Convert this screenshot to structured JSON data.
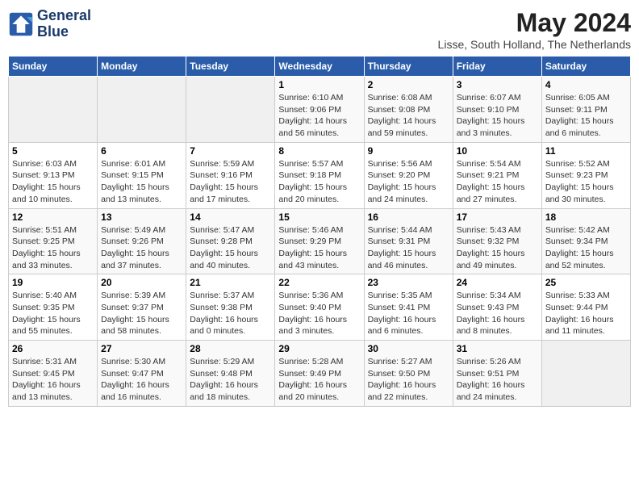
{
  "header": {
    "logo_line1": "General",
    "logo_line2": "Blue",
    "month": "May 2024",
    "location": "Lisse, South Holland, The Netherlands"
  },
  "days_of_week": [
    "Sunday",
    "Monday",
    "Tuesday",
    "Wednesday",
    "Thursday",
    "Friday",
    "Saturday"
  ],
  "weeks": [
    [
      {
        "day": "",
        "info": ""
      },
      {
        "day": "",
        "info": ""
      },
      {
        "day": "",
        "info": ""
      },
      {
        "day": "1",
        "info": "Sunrise: 6:10 AM\nSunset: 9:06 PM\nDaylight: 14 hours\nand 56 minutes."
      },
      {
        "day": "2",
        "info": "Sunrise: 6:08 AM\nSunset: 9:08 PM\nDaylight: 14 hours\nand 59 minutes."
      },
      {
        "day": "3",
        "info": "Sunrise: 6:07 AM\nSunset: 9:10 PM\nDaylight: 15 hours\nand 3 minutes."
      },
      {
        "day": "4",
        "info": "Sunrise: 6:05 AM\nSunset: 9:11 PM\nDaylight: 15 hours\nand 6 minutes."
      }
    ],
    [
      {
        "day": "5",
        "info": "Sunrise: 6:03 AM\nSunset: 9:13 PM\nDaylight: 15 hours\nand 10 minutes."
      },
      {
        "day": "6",
        "info": "Sunrise: 6:01 AM\nSunset: 9:15 PM\nDaylight: 15 hours\nand 13 minutes."
      },
      {
        "day": "7",
        "info": "Sunrise: 5:59 AM\nSunset: 9:16 PM\nDaylight: 15 hours\nand 17 minutes."
      },
      {
        "day": "8",
        "info": "Sunrise: 5:57 AM\nSunset: 9:18 PM\nDaylight: 15 hours\nand 20 minutes."
      },
      {
        "day": "9",
        "info": "Sunrise: 5:56 AM\nSunset: 9:20 PM\nDaylight: 15 hours\nand 24 minutes."
      },
      {
        "day": "10",
        "info": "Sunrise: 5:54 AM\nSunset: 9:21 PM\nDaylight: 15 hours\nand 27 minutes."
      },
      {
        "day": "11",
        "info": "Sunrise: 5:52 AM\nSunset: 9:23 PM\nDaylight: 15 hours\nand 30 minutes."
      }
    ],
    [
      {
        "day": "12",
        "info": "Sunrise: 5:51 AM\nSunset: 9:25 PM\nDaylight: 15 hours\nand 33 minutes."
      },
      {
        "day": "13",
        "info": "Sunrise: 5:49 AM\nSunset: 9:26 PM\nDaylight: 15 hours\nand 37 minutes."
      },
      {
        "day": "14",
        "info": "Sunrise: 5:47 AM\nSunset: 9:28 PM\nDaylight: 15 hours\nand 40 minutes."
      },
      {
        "day": "15",
        "info": "Sunrise: 5:46 AM\nSunset: 9:29 PM\nDaylight: 15 hours\nand 43 minutes."
      },
      {
        "day": "16",
        "info": "Sunrise: 5:44 AM\nSunset: 9:31 PM\nDaylight: 15 hours\nand 46 minutes."
      },
      {
        "day": "17",
        "info": "Sunrise: 5:43 AM\nSunset: 9:32 PM\nDaylight: 15 hours\nand 49 minutes."
      },
      {
        "day": "18",
        "info": "Sunrise: 5:42 AM\nSunset: 9:34 PM\nDaylight: 15 hours\nand 52 minutes."
      }
    ],
    [
      {
        "day": "19",
        "info": "Sunrise: 5:40 AM\nSunset: 9:35 PM\nDaylight: 15 hours\nand 55 minutes."
      },
      {
        "day": "20",
        "info": "Sunrise: 5:39 AM\nSunset: 9:37 PM\nDaylight: 15 hours\nand 58 minutes."
      },
      {
        "day": "21",
        "info": "Sunrise: 5:37 AM\nSunset: 9:38 PM\nDaylight: 16 hours\nand 0 minutes."
      },
      {
        "day": "22",
        "info": "Sunrise: 5:36 AM\nSunset: 9:40 PM\nDaylight: 16 hours\nand 3 minutes."
      },
      {
        "day": "23",
        "info": "Sunrise: 5:35 AM\nSunset: 9:41 PM\nDaylight: 16 hours\nand 6 minutes."
      },
      {
        "day": "24",
        "info": "Sunrise: 5:34 AM\nSunset: 9:43 PM\nDaylight: 16 hours\nand 8 minutes."
      },
      {
        "day": "25",
        "info": "Sunrise: 5:33 AM\nSunset: 9:44 PM\nDaylight: 16 hours\nand 11 minutes."
      }
    ],
    [
      {
        "day": "26",
        "info": "Sunrise: 5:31 AM\nSunset: 9:45 PM\nDaylight: 16 hours\nand 13 minutes."
      },
      {
        "day": "27",
        "info": "Sunrise: 5:30 AM\nSunset: 9:47 PM\nDaylight: 16 hours\nand 16 minutes."
      },
      {
        "day": "28",
        "info": "Sunrise: 5:29 AM\nSunset: 9:48 PM\nDaylight: 16 hours\nand 18 minutes."
      },
      {
        "day": "29",
        "info": "Sunrise: 5:28 AM\nSunset: 9:49 PM\nDaylight: 16 hours\nand 20 minutes."
      },
      {
        "day": "30",
        "info": "Sunrise: 5:27 AM\nSunset: 9:50 PM\nDaylight: 16 hours\nand 22 minutes."
      },
      {
        "day": "31",
        "info": "Sunrise: 5:26 AM\nSunset: 9:51 PM\nDaylight: 16 hours\nand 24 minutes."
      },
      {
        "day": "",
        "info": ""
      }
    ]
  ]
}
